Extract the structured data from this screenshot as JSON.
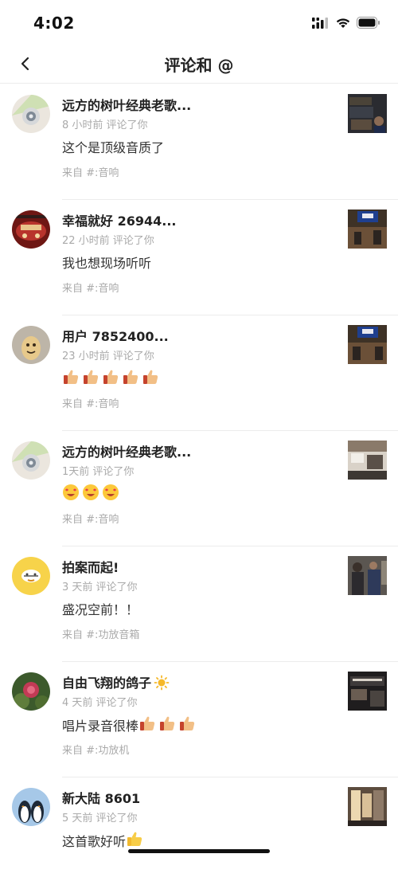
{
  "status_bar": {
    "time": "4:02"
  },
  "header": {
    "title": "评论和 @"
  },
  "feed": [
    {
      "name": "远方的树叶经典老歌...",
      "meta": "8 小时前 评论了你",
      "comment": "这个是顶级音质了",
      "emojis": [],
      "source": "来自 #:音响"
    },
    {
      "name": "幸福就好 26944...",
      "meta": "22 小时前 评论了你",
      "comment": "我也想现场听听",
      "emojis": [],
      "source": "来自 #:音响"
    },
    {
      "name": "用户 7852400...",
      "meta": "23 小时前 评论了你",
      "comment": "",
      "emojis": [
        "thumbs-up",
        "thumbs-up",
        "thumbs-up",
        "thumbs-up",
        "thumbs-up"
      ],
      "source": "来自 #:音响"
    },
    {
      "name": "远方的树叶经典老歌...",
      "meta": "1天前 评论了你",
      "comment": "",
      "emojis": [
        "money-face",
        "money-face",
        "money-face"
      ],
      "source": "来自 #:音响"
    },
    {
      "name": "拍案而起!",
      "meta": "3 天前 评论了你",
      "comment": "盛况空前！！",
      "emojis": [],
      "source": "来自 #:功放音箱"
    },
    {
      "name": "自由飞翔的鸽子",
      "name_emoji": "sun",
      "meta": "4 天前 评论了你",
      "comment": "唱片录音很棒",
      "emojis": [
        "thumbs-up",
        "thumbs-up",
        "thumbs-up"
      ],
      "source": "来自 #:功放机"
    },
    {
      "name": "新大陆 8601",
      "meta": "5 天前 评论了你",
      "comment": "这首歌好听",
      "emojis": [
        "thumbs-up-yellow"
      ],
      "source": ""
    }
  ]
}
